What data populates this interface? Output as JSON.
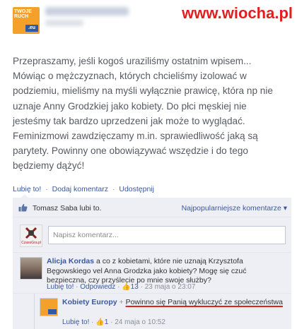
{
  "header": {
    "logo_top_text": "TWOJE RUCH",
    "logo_badge_text": ".eu",
    "watermark": "www.wiocha.pl"
  },
  "post": {
    "lines": [
      "Przepraszamy, jeśli kogoś uraziliśmy ostatnim wpisem...",
      "Mówiąc o mężczyznach, których chcieliśmy izolować w",
      "podziemiu, mieliśmy na myśli wyłącznie prawicę, która np nie",
      "uznaje Anny Grodzkiej jako kobiety. Do płci męskiej nie",
      "jesteśmy tak bardzo uprzedzeni jak może to wyglądać.",
      "Feminizmowi zawdzięczamy m.in. sprawiedliwość jaką są",
      "parytety. Powinny one obowiązywać wszędzie i do tego",
      "będziemy dążyć!"
    ]
  },
  "actions": {
    "like": "Lubię to!",
    "comment": "Dodaj komentarz",
    "share": "Udostępnij",
    "separator": "·"
  },
  "likes": {
    "text": "Tomasz Saba lubi to.",
    "sort": "Najpopularniejsze komentarze ▾"
  },
  "write_comment": {
    "avatar_text": "CzasoGra.pl",
    "placeholder": "Napisz komentarz..."
  },
  "comments": [
    {
      "author": "Alicja Kordas",
      "text": " a co z kobietami, które nie uznają Krzysztofa Bęgowskiego vel Anna Grodzka jako kobiety? Mogę się czuć bezpieczna, czy przyślecie po mnie swoje służby?",
      "like": "Lubię to!",
      "reply": "Odpowiedz",
      "likes_count": "13",
      "time": "23 maja o 23:07",
      "separator": "·"
    },
    {
      "author": "Kobiety Europy",
      "plus": "+",
      "text": "Powinno się Panią wykluczyć ze społeczeństwa",
      "like": "Lubię to!",
      "likes_count": "1",
      "time": "24 maja o 10:52",
      "separator": "·"
    }
  ],
  "colors": {
    "link": "#3b5998",
    "body_text": "#555a63",
    "feedback_bg": "#edeff4",
    "watermark": "#e21f1f",
    "logo_orange": "#f4a12c"
  },
  "icons": [
    "thumbs-up-icon",
    "sort-chevron-icon"
  ]
}
